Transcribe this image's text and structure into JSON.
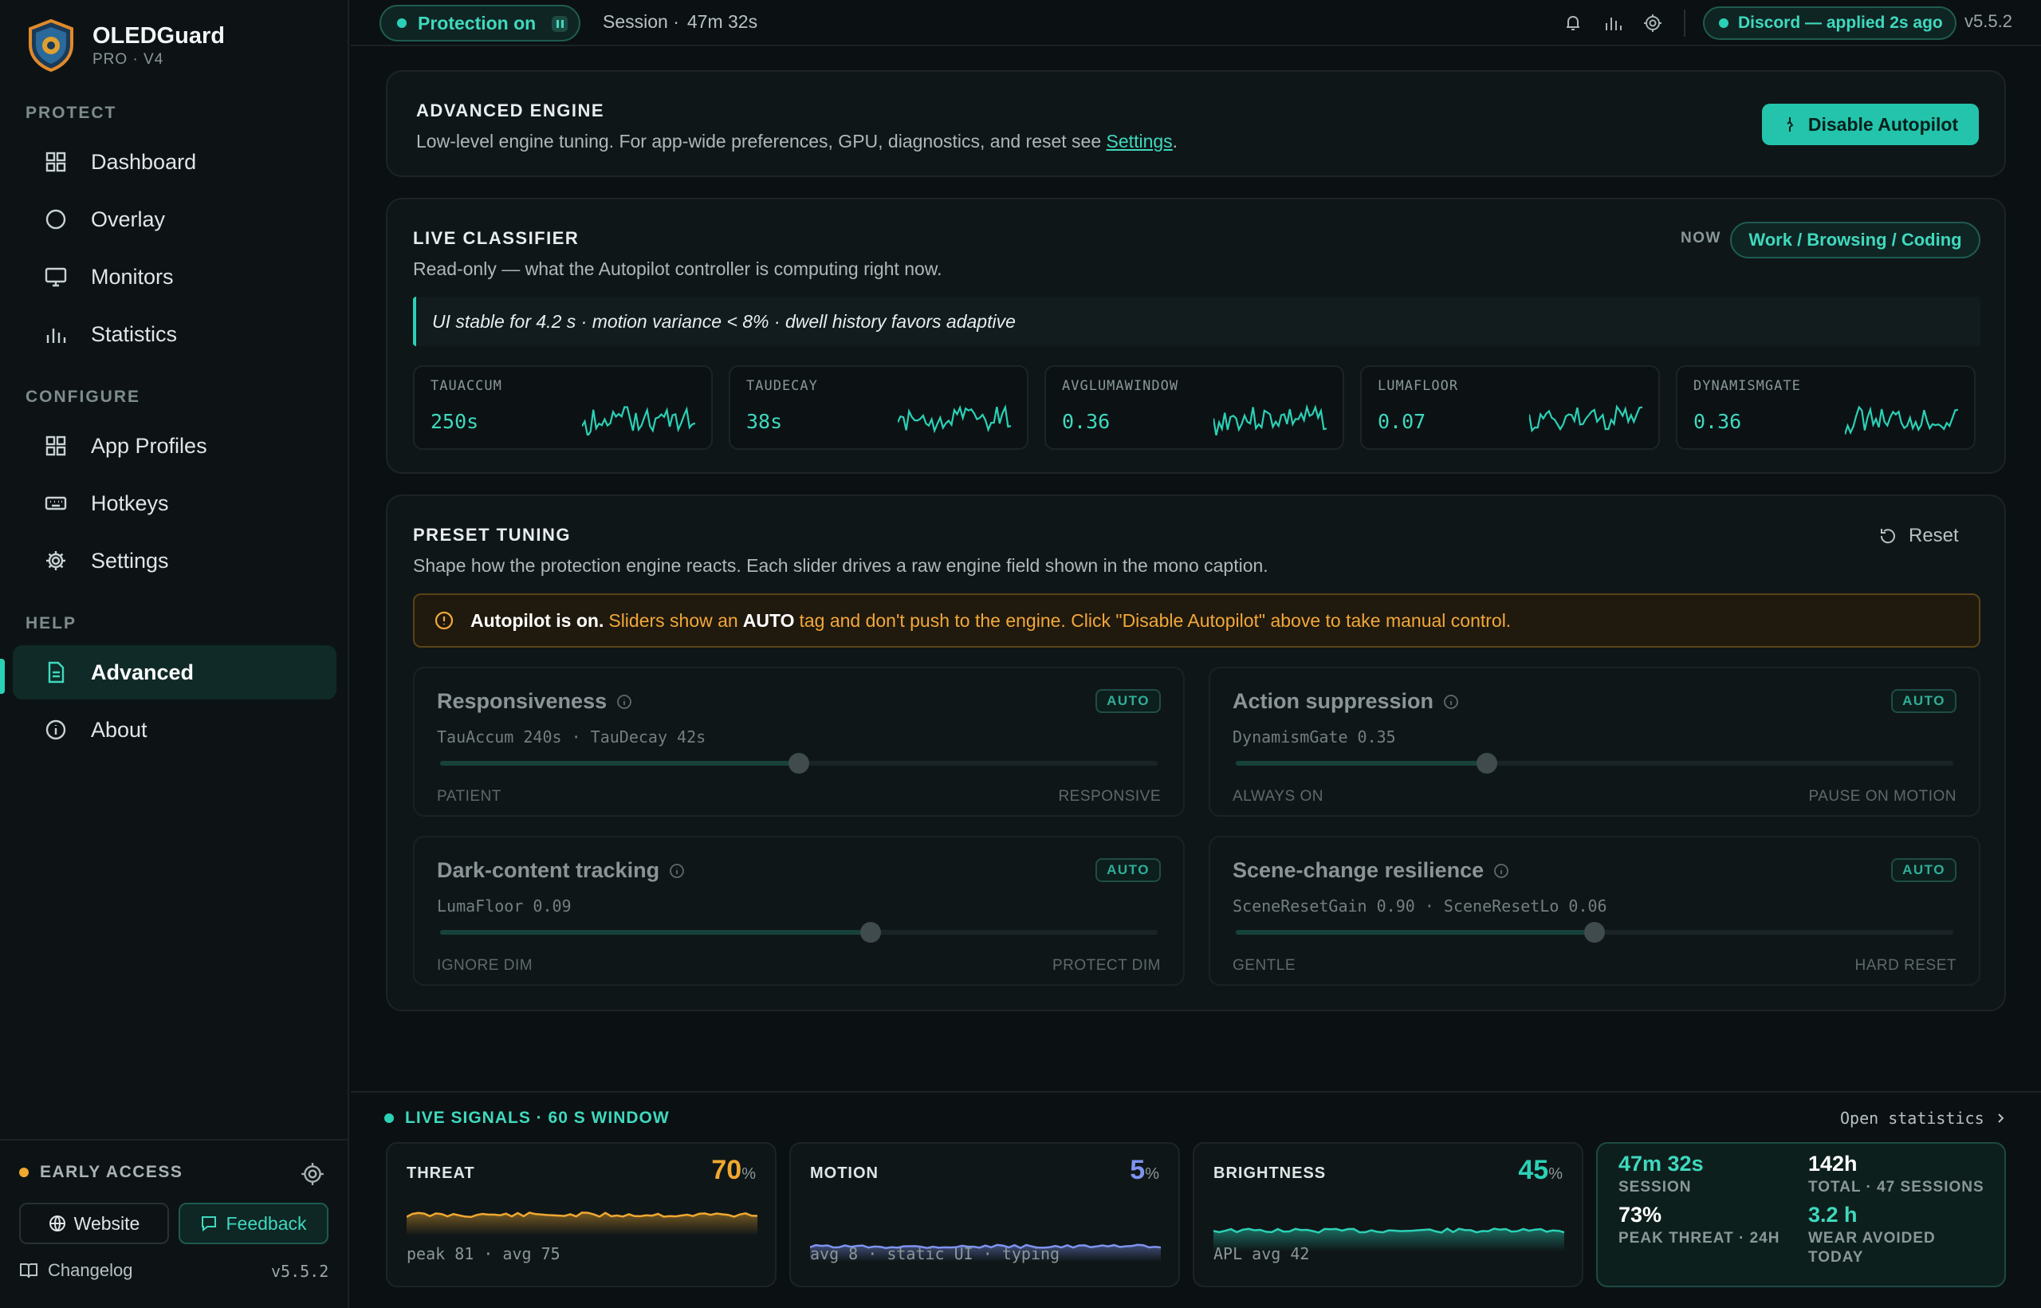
{
  "app": {
    "name": "OLEDGuard",
    "edition": "PRO · V4"
  },
  "sidebar": {
    "sections": {
      "protect": "PROTECT",
      "configure": "CONFIGURE",
      "help": "HELP"
    },
    "items": [
      {
        "label": "Dashboard",
        "icon": "grid-icon"
      },
      {
        "label": "Overlay",
        "icon": "circle-icon"
      },
      {
        "label": "Monitors",
        "icon": "monitor-icon"
      },
      {
        "label": "Statistics",
        "icon": "bar-chart-icon"
      },
      {
        "label": "App Profiles",
        "icon": "grid-icon"
      },
      {
        "label": "Hotkeys",
        "icon": "keyboard-icon"
      },
      {
        "label": "Settings",
        "icon": "gear-icon"
      },
      {
        "label": "Advanced",
        "icon": "document-icon",
        "active": true
      },
      {
        "label": "About",
        "icon": "info-icon"
      }
    ],
    "early_access": "EARLY ACCESS",
    "website_label": "Website",
    "feedback_label": "Feedback",
    "changelog_label": "Changelog",
    "version": "v5.5.2"
  },
  "topbar": {
    "protection_label": "Protection on",
    "session_label": "Session ·",
    "session_value": "47m 32s",
    "discord_label": "Discord — applied 2s ago",
    "version": "v5.5.2"
  },
  "engine": {
    "title": "ADVANCED ENGINE",
    "description": "Low-level engine tuning. For app-wide preferences, GPU, diagnostics, and reset see",
    "settings_link": "Settings",
    "disable_label": "Disable Autopilot"
  },
  "classifier": {
    "title": "LIVE CLASSIFIER",
    "description": "Read-only — what the Autopilot controller is computing right now.",
    "now_label": "NOW",
    "mode": "Work / Browsing / Coding",
    "reason": "UI stable for 4.2 s · motion variance < 8% · dwell history favors adaptive",
    "metrics": [
      {
        "name": "TAUACCUM",
        "value": "250s"
      },
      {
        "name": "TAUDECAY",
        "value": "38s"
      },
      {
        "name": "AVGLUMAWINDOW",
        "value": "0.36"
      },
      {
        "name": "LUMAFLOOR",
        "value": "0.07"
      },
      {
        "name": "DYNAMISMGATE",
        "value": "0.36"
      }
    ]
  },
  "preset": {
    "title": "PRESET TUNING",
    "description": "Shape how the protection engine reacts. Each slider drives a raw engine field shown in the mono caption.",
    "reset_label": "Reset",
    "banner_bold": "Autopilot is on.",
    "banner_a": "Sliders show an",
    "banner_auto": "AUTO",
    "banner_b": "tag and don't push to the engine. Click \"Disable Autopilot\" above to take manual control.",
    "auto_tag": "AUTO",
    "sliders": [
      {
        "title": "Responsiveness",
        "field": "TauAccum 240s · TauDecay 42s",
        "low": "PATIENT",
        "high": "RESPONSIVE",
        "value": 0.5
      },
      {
        "title": "Action suppression",
        "field": "DynamismGate 0.35",
        "low": "ALWAYS ON",
        "high": "PAUSE ON MOTION",
        "value": 0.35
      },
      {
        "title": "Dark-content tracking",
        "field": "LumaFloor 0.09",
        "low": "IGNORE DIM",
        "high": "PROTECT DIM",
        "value": 0.6
      },
      {
        "title": "Scene-change resilience",
        "field": "SceneResetGain 0.90 · SceneResetLo 0.06",
        "low": "GENTLE",
        "high": "HARD RESET",
        "value": 0.5
      }
    ]
  },
  "signals": {
    "header": "LIVE SIGNALS · 60 S WINDOW",
    "open_stats": "Open statistics",
    "cards": [
      {
        "name": "THREAT",
        "value": "70",
        "unit": "%",
        "color": "#f0a830",
        "footer": "peak 81 · avg 75"
      },
      {
        "name": "MOTION",
        "value": "5",
        "unit": "%",
        "color": "#7f93f0",
        "footer": "avg 8 · static UI · typing"
      },
      {
        "name": "BRIGHTNESS",
        "value": "45",
        "unit": "%",
        "color": "#2bd1b6",
        "footer": "APL avg 42"
      }
    ],
    "summary": [
      {
        "value": "47m 32s",
        "label": "SESSION"
      },
      {
        "value": "142h",
        "label": "TOTAL · 47 SESSIONS"
      },
      {
        "value": "73%",
        "label": "PEAK THREAT · 24H"
      },
      {
        "value": "3.2 h",
        "label": "WEAR AVOIDED TODAY"
      }
    ]
  }
}
